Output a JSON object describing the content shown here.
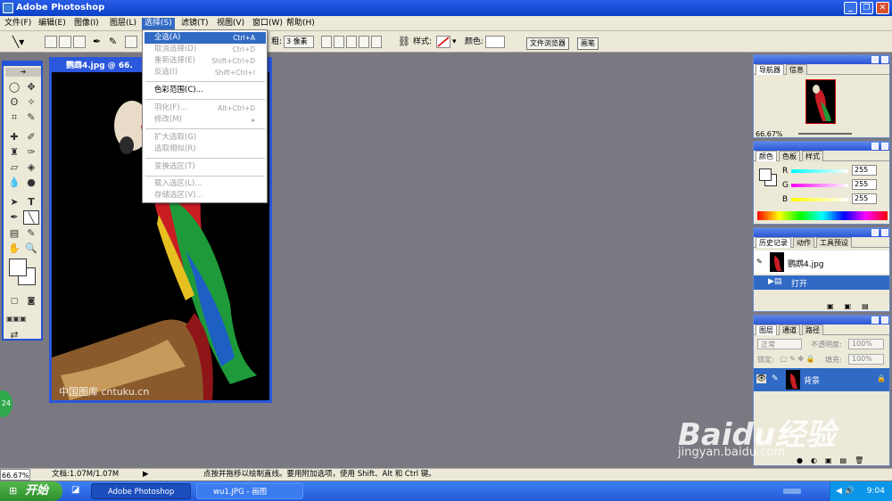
{
  "window": {
    "title": "Adobe Photoshop"
  },
  "menubar": {
    "items": [
      "文件(F)",
      "编辑(E)",
      "图像(I)",
      "图层(L)",
      "选择(S)",
      "滤镜(T)",
      "视图(V)",
      "窗口(W)",
      "帮助(H)"
    ],
    "active_index": 4
  },
  "options_bar": {
    "weight_label": "粗:",
    "weight_value": "3 像素",
    "style_label": "样式:",
    "color_label": "颜色:",
    "tab_file_browser": "文件浏览器",
    "tab_brushes": "画笔"
  },
  "document": {
    "title": "鹦鹉4.jpg @ 66.",
    "watermark": "中国图库 cntuku.cn"
  },
  "select_menu": {
    "items": [
      {
        "label": "全选(A)",
        "shortcut": "Ctrl+A"
      },
      {
        "label": "取消选择(D)",
        "shortcut": "Ctrl+D"
      },
      {
        "label": "重新选择(E)",
        "shortcut": "Shift+Ctrl+D"
      },
      {
        "label": "反选(I)",
        "shortcut": "Shift+Ctrl+I"
      },
      {
        "label": "色彩范围(C)...",
        "shortcut": ""
      },
      {
        "label": "羽化(F)...",
        "shortcut": "Alt+Ctrl+D"
      },
      {
        "label": "修改(M)",
        "shortcut": "▸"
      },
      {
        "label": "扩大选取(G)",
        "shortcut": ""
      },
      {
        "label": "选取相似(R)",
        "shortcut": ""
      },
      {
        "label": "变换选区(T)",
        "shortcut": ""
      },
      {
        "label": "载入选区(L)...",
        "shortcut": ""
      },
      {
        "label": "存储选区(V)...",
        "shortcut": ""
      }
    ]
  },
  "navigator": {
    "tab1": "导航器",
    "tab2": "信息",
    "zoom": "66.67%"
  },
  "color_panel": {
    "tab1": "颜色",
    "tab2": "色板",
    "tab3": "样式",
    "r_label": "R",
    "g_label": "G",
    "b_label": "B",
    "r": "255",
    "g": "255",
    "b": "255"
  },
  "history_panel": {
    "tab1": "历史记录",
    "tab2": "动作",
    "tab3": "工具预设",
    "snapshot": "鹦鹉4.jpg",
    "state": "打开"
  },
  "layers_panel": {
    "tab1": "图层",
    "tab2": "通道",
    "tab3": "路径",
    "blend_mode": "正常",
    "opacity_label": "不透明度:",
    "opacity": "100%",
    "lock_label": "锁定:",
    "fill_label": "填充:",
    "fill": "100%",
    "layer_name": "背景"
  },
  "statusbar": {
    "zoom": "66.67%",
    "doc": "文档:1.07M/1.07M",
    "hint": "点按并拖移以绘制直线。要用附加选项，使用 Shift、Alt 和 Ctrl 键。"
  },
  "taskbar": {
    "start": "开始",
    "task1": "Adobe Photoshop",
    "task2": "wu1.JPG - 画图",
    "time": "9:04"
  },
  "badge": "24",
  "site_watermark": {
    "main": "Baidu经验",
    "sub": "jingyan.baidu.com"
  }
}
